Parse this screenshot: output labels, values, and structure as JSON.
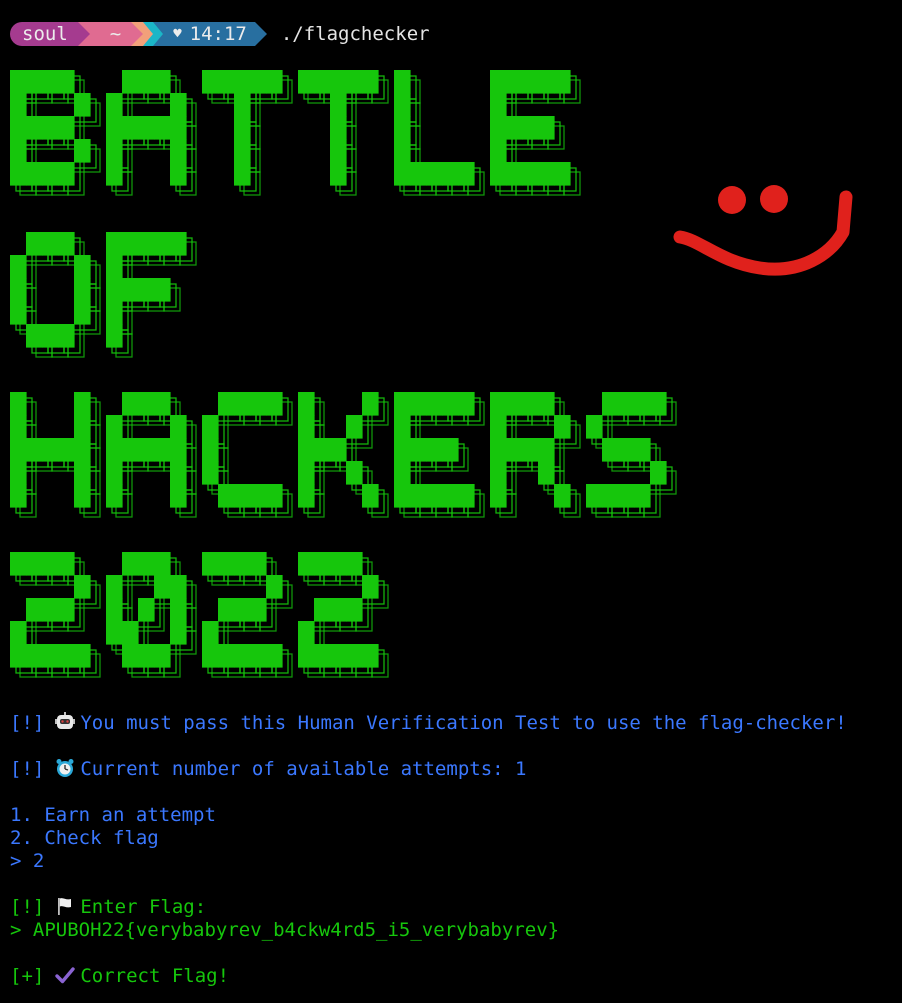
{
  "prompt": {
    "user": "soul",
    "dir": "~",
    "time": "14:17",
    "command": "./flagchecker"
  },
  "banner": {
    "lines": [
      "BATTLE",
      "OF",
      "HACKERS",
      "2022"
    ],
    "color": "#16c60c"
  },
  "smiley": {
    "color": "#e0211c"
  },
  "output": {
    "verify": {
      "tag": "[!]",
      "icon": "robot-icon",
      "text": "You must pass this Human Verification Test to use the flag-checker!"
    },
    "attempts": {
      "tag": "[!]",
      "icon": "alarm-clock-icon",
      "text": "Current number of available attempts: 1"
    },
    "menu": [
      "1. Earn an attempt",
      "2. Check flag",
      "> 2"
    ],
    "enter_flag": {
      "tag": "[!]",
      "icon": "white-flag-icon",
      "text": "Enter Flag:"
    },
    "flag_input": "> APUBOH22{verybabyrev_b4ckw4rd5_i5_verybabyrev}",
    "result": {
      "tag": "[+]",
      "icon": "check-mark-icon",
      "text": "Correct Flag!"
    }
  },
  "colors": {
    "info": "#3b78ff",
    "success": "#16c60c",
    "background": "#000000"
  }
}
